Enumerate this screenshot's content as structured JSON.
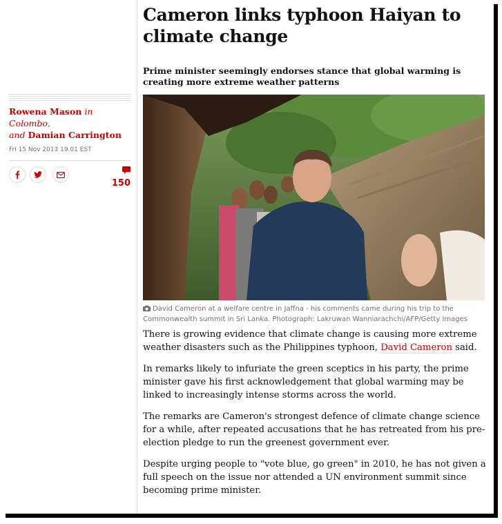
{
  "article": {
    "headline": "Cameron links typhoon Haiyan to climate change",
    "standfirst": "Prime minister seemingly endorses stance that global warming is creating more extreme weather patterns",
    "byline": {
      "author1": "Rowena Mason",
      "location": "in Colombo,",
      "and": "and",
      "author2": "Damian Carrington"
    },
    "date": "Fri 15 Nov 2013 19.01 EST",
    "comment_count": "150",
    "caption": "David Cameron at a welfare centre in Jaffna - his comments came during his trip to the Commonwealth summit in Sri Lanka. Photograph: Lakruwan Wanniarachchi/AFP/Getty Images",
    "paragraphs": {
      "p1_before": "There is growing evidence that climate change is causing more extreme weather disasters such as the Philippines typhoon, ",
      "p1_link": "David Cameron",
      "p1_after": " said.",
      "p2": "In remarks likely to infuriate the green sceptics in his party, the prime minister gave his first acknowledgement that global warming may be linked to increasingly intense storms across the world.",
      "p3": "The remarks are Cameron's strongest defence of climate change science for a while, after repeated accusations that he has retreated from his pre-election pledge to run the greenest government ever.",
      "p4": "Despite urging people to \"vote blue, go green\" in 2010, he has not given a full speech on the issue nor attended a UN environment summit since becoming prime minister."
    }
  },
  "share": {
    "icons": [
      "facebook-icon",
      "twitter-icon",
      "email-icon"
    ]
  },
  "colors": {
    "accent": "#c70000",
    "text": "#121212",
    "muted": "#707070",
    "rule": "#dcdcdc"
  }
}
